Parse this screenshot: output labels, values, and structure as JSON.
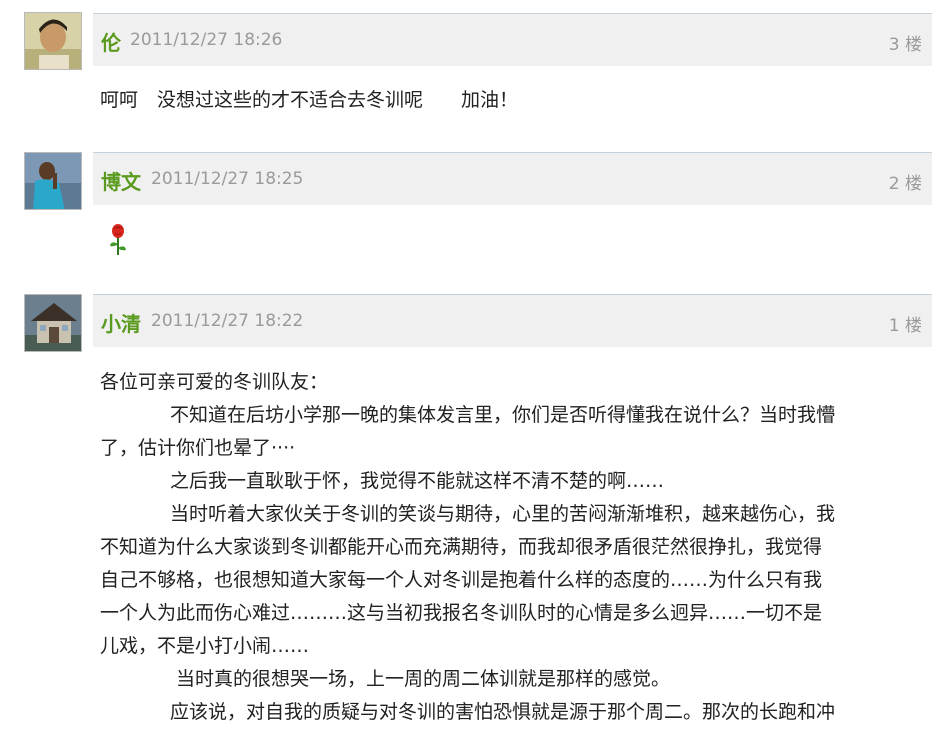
{
  "comments": [
    {
      "user": "伦",
      "time": "2011/12/27 18:26",
      "floor": "3 楼",
      "text": "呵呵　没想过这些的才不适合去冬训呢　　加油！"
    },
    {
      "user": "博文",
      "time": "2011/12/27 18:25",
      "floor": "2 楼",
      "emoticon": "rose-emoticon"
    },
    {
      "user": "小清",
      "time": "2011/12/27 18:22",
      "floor": "1 楼",
      "paragraphs": [
        "各位可亲可爱的冬训队友：",
        "不知道在后坊小学那一晚的集体发言里，你们是否听得懂我在说什么？当时我懵",
        "了，估计你们也晕了····",
        "之后我一直耿耿于怀，我觉得不能就这样不清不楚的啊……",
        "当时听着大家伙关于冬训的笑谈与期待，心里的苦闷渐渐堆积，越来越伤心，我",
        "不知道为什么大家谈到冬训都能开心而充满期待，而我却很矛盾很茫然很挣扎，我觉得",
        "自己不够格，也很想知道大家每一个人对冬训是抱着什么样的态度的……为什么只有我",
        "一个人为此而伤心难过………这与当初我报名冬训队时的心情是多么迥异……一切不是",
        "儿戏，不是小打小闹……",
        "当时真的很想哭一场，上一周的周二体训就是那样的感觉。",
        "应该说，对自我的质疑与对冬训的害怕恐惧就是源于那个周二。那次的长跑和冲"
      ]
    }
  ]
}
